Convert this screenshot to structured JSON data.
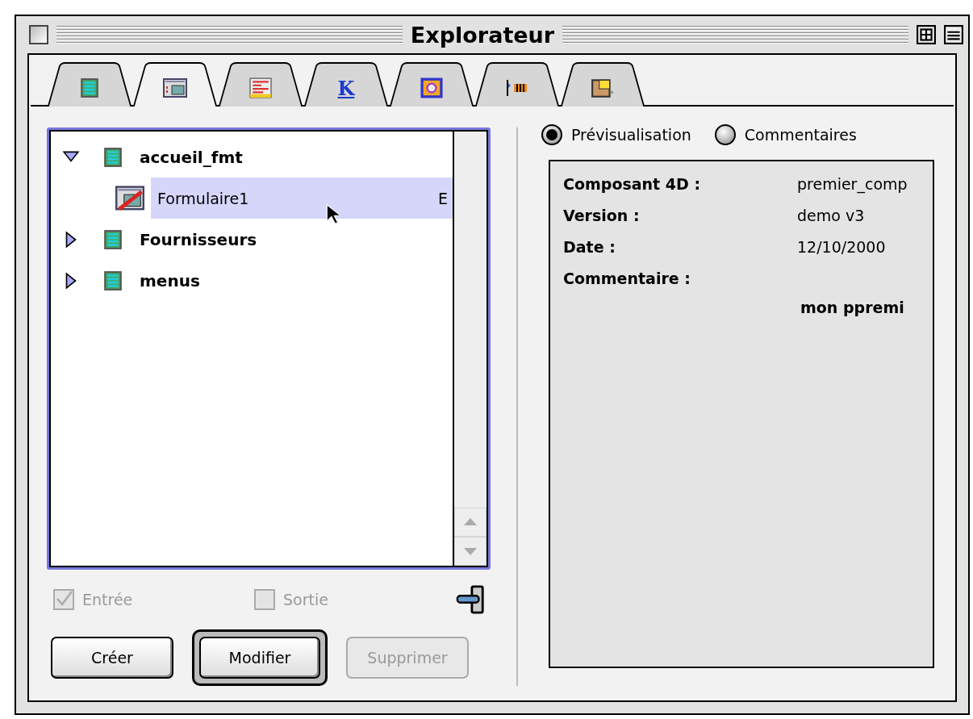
{
  "window": {
    "title": "Explorateur"
  },
  "tabs": [
    {
      "selected": false
    },
    {
      "selected": true
    },
    {
      "selected": false
    },
    {
      "label": "K",
      "selected": false
    },
    {
      "selected": false
    },
    {
      "selected": false
    },
    {
      "selected": false
    }
  ],
  "tree": {
    "items": [
      {
        "label": "accueil_fmt",
        "expanded": true,
        "selected": false,
        "children": [
          {
            "label": "Formulaire1",
            "flag": "E",
            "selected": true
          }
        ]
      },
      {
        "label": "Fournisseurs",
        "expanded": false,
        "selected": false
      },
      {
        "label": "menus",
        "expanded": false,
        "selected": false
      }
    ]
  },
  "options": [
    {
      "label": "Entrée",
      "checked": true,
      "disabled": true
    },
    {
      "label": "Sortie",
      "checked": false,
      "disabled": true
    }
  ],
  "buttons": [
    {
      "label": "Créer",
      "default": false,
      "disabled": false
    },
    {
      "label": "Modifier",
      "default": true,
      "disabled": false
    },
    {
      "label": "Supprimer",
      "default": false,
      "disabled": true
    }
  ],
  "view_modes": [
    {
      "label": "Prévisualisation",
      "selected": true
    },
    {
      "label": "Commentaires",
      "selected": false
    }
  ],
  "preview": {
    "rows": [
      {
        "label": "Composant 4D :",
        "value": "premier_comp"
      },
      {
        "label": "Version :",
        "value": "demo v3"
      },
      {
        "label": "Date :",
        "value": "12/10/2000"
      },
      {
        "label": "Commentaire :"
      }
    ],
    "comment": "mon ppremi"
  }
}
